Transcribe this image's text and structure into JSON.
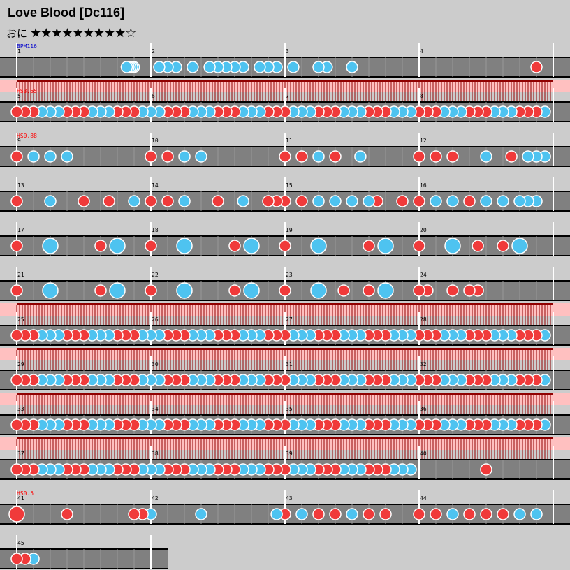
{
  "song": {
    "title": "Love Blood [Dc116]",
    "difficulty_label": "おに",
    "stars": "★★★★★★★★★☆"
  },
  "colors": {
    "background": "#cccccc",
    "lane": "#808080",
    "lane_border": "#000000",
    "don": "#f03a3a",
    "ka": "#4ec3f0",
    "note_outline": "#ffffff",
    "barline": "#ffffff",
    "roll_bg": "#ffc0c0",
    "roll_tick": "#900000",
    "bpm_text": "#0000cc",
    "hs_text": "#ff0000"
  },
  "chart_data": {
    "type": "taiko-chart",
    "bpm": 116,
    "measures_total": 45,
    "measures_per_row": 4,
    "events": [
      {
        "measure": 1,
        "label": "BPM116",
        "kind": "bpm"
      },
      {
        "measure": 5,
        "label": "HS3.55",
        "kind": "hs"
      },
      {
        "measure": 9,
        "label": "HS0.88",
        "kind": "hs"
      },
      {
        "measure": 41,
        "label": "HS0.5",
        "kind": "hs"
      }
    ],
    "rolls": [
      {
        "row": 1,
        "label_unit": "3",
        "label_alt": "0"
      },
      {
        "row": 6,
        "label_unit": "",
        "label_alt": ""
      },
      {
        "row": 7,
        "label_unit": "",
        "label_alt": ""
      },
      {
        "row": 8,
        "label_unit": "",
        "label_alt": ""
      },
      {
        "row": 9,
        "label_unit": "",
        "label_alt": ""
      }
    ],
    "rows": [
      {
        "notes": [
          [
            0.82,
            "k"
          ],
          [
            0.833,
            "k"
          ],
          [
            0.846,
            "k"
          ],
          [
            0.86,
            "k"
          ],
          [
            0.873,
            "k"
          ],
          [
            1.062,
            "k"
          ],
          [
            1.125,
            "k"
          ],
          [
            1.188,
            "k"
          ],
          [
            1.312,
            "k"
          ],
          [
            1.438,
            "k"
          ],
          [
            1.5,
            "k"
          ],
          [
            1.562,
            "k"
          ],
          [
            1.625,
            "k"
          ],
          [
            1.688,
            "k"
          ],
          [
            1.812,
            "k"
          ],
          [
            1.875,
            "k"
          ],
          [
            1.938,
            "k"
          ],
          [
            2.062,
            "k"
          ],
          [
            2.25,
            "k"
          ],
          [
            2.312,
            "k"
          ],
          [
            2.5,
            "k"
          ],
          [
            3.875,
            "d"
          ]
        ]
      },
      {
        "pattern": "dense16",
        "from": 0,
        "to": 4
      },
      {
        "notes": [
          [
            0,
            "d"
          ],
          [
            0.125,
            "k"
          ],
          [
            0.25,
            "k"
          ],
          [
            0.375,
            "k"
          ],
          [
            1,
            "d"
          ],
          [
            1.125,
            "d"
          ],
          [
            1.25,
            "k"
          ],
          [
            1.375,
            "k"
          ],
          [
            2,
            "d"
          ],
          [
            2.125,
            "d"
          ],
          [
            2.25,
            "k"
          ],
          [
            2.375,
            "d"
          ],
          [
            2.562,
            "k"
          ],
          [
            3,
            "d"
          ],
          [
            3.125,
            "d"
          ],
          [
            3.25,
            "d"
          ],
          [
            3.5,
            "k"
          ],
          [
            3.688,
            "d"
          ],
          [
            3.812,
            "k"
          ],
          [
            3.875,
            "k"
          ],
          [
            3.938,
            "k"
          ]
        ]
      },
      {
        "notes": [
          [
            0,
            "d"
          ],
          [
            0.25,
            "k"
          ],
          [
            0.5,
            "d"
          ],
          [
            0.688,
            "d"
          ],
          [
            0.875,
            "k"
          ],
          [
            1,
            "d"
          ],
          [
            1.125,
            "d"
          ],
          [
            1.25,
            "k"
          ],
          [
            1.5,
            "d"
          ],
          [
            1.688,
            "k"
          ],
          [
            1.875,
            "d"
          ],
          [
            1.938,
            "d"
          ],
          [
            2,
            "d"
          ],
          [
            2.125,
            "d"
          ],
          [
            2.25,
            "k"
          ],
          [
            2.375,
            "k"
          ],
          [
            2.5,
            "k"
          ],
          [
            2.625,
            "k"
          ],
          [
            2.688,
            "d"
          ],
          [
            2.875,
            "d"
          ],
          [
            3,
            "d"
          ],
          [
            3.125,
            "k"
          ],
          [
            3.25,
            "k"
          ],
          [
            3.375,
            "d"
          ],
          [
            3.5,
            "k"
          ],
          [
            3.625,
            "k"
          ],
          [
            3.75,
            "k"
          ],
          [
            3.812,
            "k"
          ],
          [
            3.875,
            "k"
          ]
        ]
      },
      {
        "notes": [
          [
            0,
            "d"
          ],
          [
            0.25,
            "K"
          ],
          [
            0.625,
            "d"
          ],
          [
            0.75,
            "K"
          ],
          [
            1,
            "d"
          ],
          [
            1.25,
            "K"
          ],
          [
            1.625,
            "d"
          ],
          [
            1.75,
            "K"
          ],
          [
            2,
            "d"
          ],
          [
            2.25,
            "K"
          ],
          [
            2.625,
            "d"
          ],
          [
            2.75,
            "K"
          ],
          [
            3,
            "d"
          ],
          [
            3.25,
            "K"
          ],
          [
            3.438,
            "d"
          ],
          [
            3.625,
            "d"
          ],
          [
            3.75,
            "K"
          ]
        ]
      },
      {
        "notes": [
          [
            0,
            "d"
          ],
          [
            0.25,
            "K"
          ],
          [
            0.625,
            "d"
          ],
          [
            0.75,
            "K"
          ],
          [
            1,
            "d"
          ],
          [
            1.25,
            "K"
          ],
          [
            1.625,
            "d"
          ],
          [
            1.75,
            "K"
          ],
          [
            2,
            "d"
          ],
          [
            2.25,
            "K"
          ],
          [
            2.438,
            "d"
          ],
          [
            2.625,
            "d"
          ],
          [
            2.75,
            "K"
          ],
          [
            3,
            "d"
          ],
          [
            3.062,
            "d"
          ],
          [
            3.25,
            "d"
          ],
          [
            3.375,
            "d"
          ],
          [
            3.438,
            "d"
          ]
        ]
      },
      {
        "pattern": "dense16",
        "from": 0,
        "to": 4
      },
      {
        "pattern": "dense16",
        "from": 0,
        "to": 4
      },
      {
        "pattern": "dense16",
        "from": 0,
        "to": 4
      },
      {
        "pattern": "dense16",
        "from": 0,
        "to": 3,
        "extra": [
          [
            3.5,
            "d"
          ]
        ]
      },
      {
        "notes": [
          [
            0,
            "D"
          ],
          [
            0.375,
            "d"
          ],
          [
            0.875,
            "d"
          ],
          [
            0.938,
            "d"
          ],
          [
            1,
            "k"
          ],
          [
            1.375,
            "k"
          ],
          [
            1.938,
            "k"
          ],
          [
            2,
            "d"
          ],
          [
            2.125,
            "k"
          ],
          [
            2.25,
            "d"
          ],
          [
            2.375,
            "d"
          ],
          [
            2.5,
            "k"
          ],
          [
            2.625,
            "d"
          ],
          [
            2.75,
            "d"
          ],
          [
            3,
            "d"
          ],
          [
            3.125,
            "d"
          ],
          [
            3.25,
            "k"
          ],
          [
            3.375,
            "d"
          ],
          [
            3.5,
            "d"
          ],
          [
            3.625,
            "d"
          ],
          [
            3.75,
            "k"
          ],
          [
            3.875,
            "k"
          ]
        ]
      },
      {
        "measures": 1,
        "notes": [
          [
            0,
            "d"
          ],
          [
            0.062,
            "d"
          ],
          [
            0.125,
            "k"
          ]
        ]
      }
    ]
  }
}
